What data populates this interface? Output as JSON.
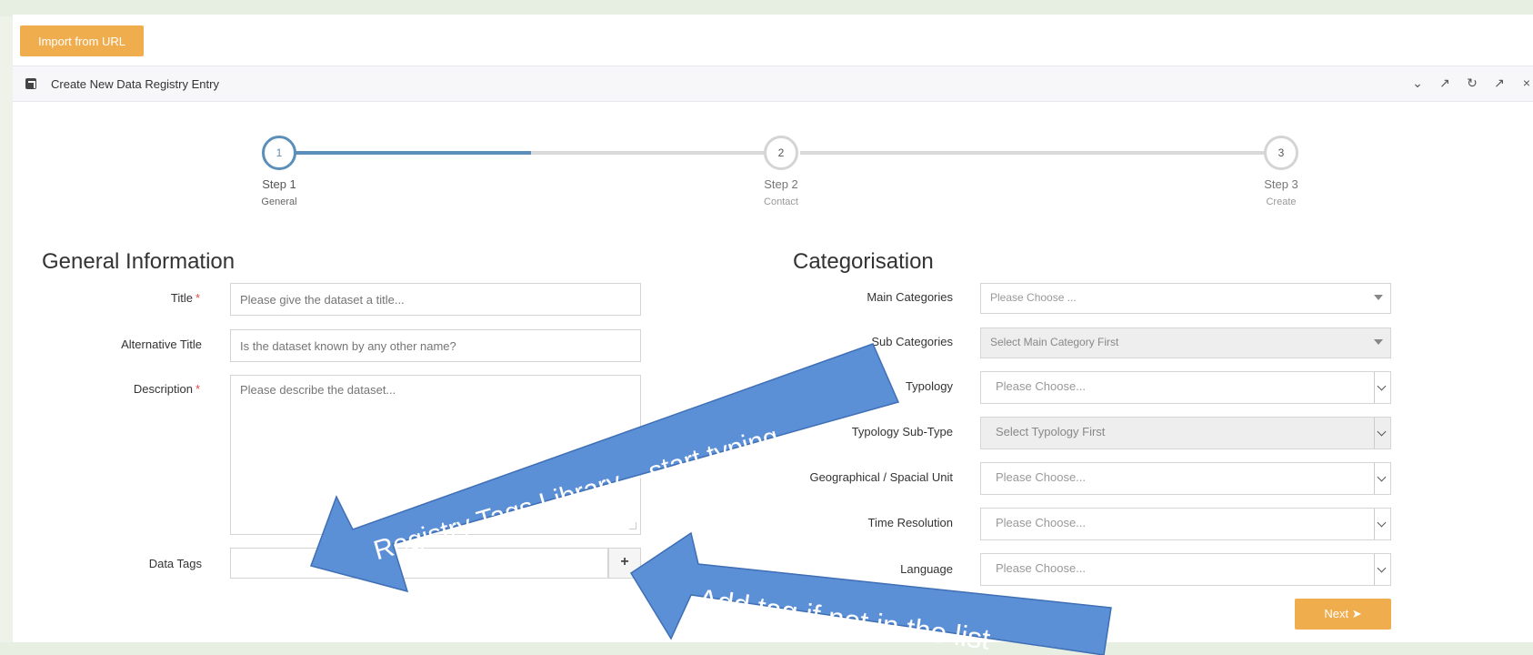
{
  "header": {
    "import_button": "Import from URL",
    "widget_title": "Create New Data Registry Entry",
    "toolbar_icons": [
      "chevron-down-icon",
      "wrench-icon",
      "refresh-icon",
      "expand-icon",
      "close-icon"
    ]
  },
  "steps": [
    {
      "number": "1",
      "label": "Step 1",
      "sub": "General"
    },
    {
      "number": "2",
      "label": "Step 2",
      "sub": "Contact"
    },
    {
      "number": "3",
      "label": "Step 3",
      "sub": "Create"
    }
  ],
  "general": {
    "heading": "General Information",
    "title_label": "Title",
    "title_placeholder": "Please give the dataset a title...",
    "alt_title_label": "Alternative Title",
    "alt_title_placeholder": "Is the dataset known by any other name?",
    "description_label": "Description",
    "description_placeholder": "Please describe the dataset...",
    "data_tags_label": "Data Tags",
    "required_mark": "*",
    "add_tag_glyph": "+"
  },
  "categorisation": {
    "heading": "Categorisation",
    "main_categories_label": "Main Categories",
    "main_categories_value": "Please Choose ...",
    "sub_categories_label": "Sub Categories",
    "sub_categories_value": "Select Main Category First",
    "typology_label": "Typology",
    "typology_value": "Please Choose...",
    "typology_subtype_label": "Typology Sub-Type",
    "typology_subtype_value": "Select Typology First",
    "geo_label": "Geographical / Spacial Unit",
    "geo_value": "Please Choose...",
    "time_label": "Time Resolution",
    "time_value": "Please Choose...",
    "language_label": "Language",
    "language_value": "Please Choose...",
    "next_button": "Next"
  },
  "callouts": {
    "tags_library": "Registry Tags Library – start typing",
    "add_tag": "Add tag if not in the list",
    "arrow_color": "#5b8fd6"
  }
}
